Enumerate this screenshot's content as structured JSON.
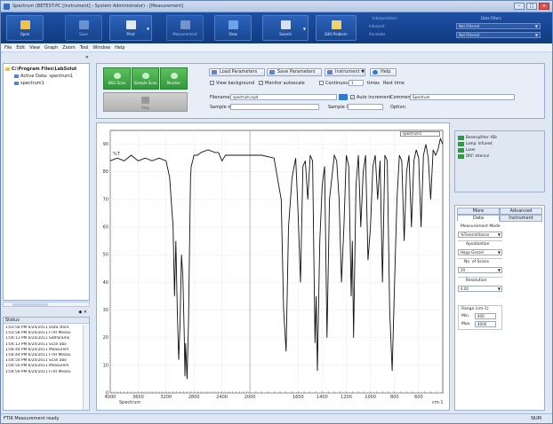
{
  "window": {
    "title": "Spectrum (BETEST-PC [Instrument] - System Administrator) - [Measurement]",
    "controls": [
      "–",
      "□",
      "✕"
    ]
  },
  "ribbon": {
    "buttons": [
      {
        "label": "Open"
      },
      {
        "label": "Save"
      },
      {
        "label": "Print"
      },
      {
        "label": "Measurement"
      },
      {
        "label": "View"
      },
      {
        "label": "Search"
      },
      {
        "label": "Edit Problem"
      }
    ],
    "groups": {
      "interpretation": {
        "label": "Interpretation",
        "items": [
          "Interpret",
          "Annotate"
        ]
      },
      "data_filters": {
        "label": "Data Filters",
        "filter1": "Not Filtered",
        "filter2": "Not Filtered"
      }
    }
  },
  "menu": [
    "File",
    "Edit",
    "View",
    "Graph",
    "Zoom",
    "Tool",
    "Window",
    "Help"
  ],
  "tree": {
    "root": "C:\\Program Files\\LabSolut",
    "items": [
      "Active Data: spectrum1",
      "spectrum1"
    ]
  },
  "status_panel": {
    "title": "Status",
    "lines": [
      "1:03:58 PM 6/20/2011 Data store",
      "1:03:58 PM 6/20/2011 FTIR Measu",
      "1:04:13 PM 6/20/2011 SetParame",
      "1:04:13 PM 6/20/2011 Scan abo",
      "1:04:44 PM 6/20/2011 Measurem",
      "1:04:44 PM 6/20/2011 FTIR Measu",
      "1:04:50 PM 6/20/2011 Scan abo",
      "1:04:50 PM 6/20/2011 Measurem",
      "1:04:59 PM 6/20/2011 FTIR Measu"
    ]
  },
  "controls": {
    "bkg_scan": "BKG Scan",
    "sample_scan": "Sample Scan",
    "monitor": "Monitor",
    "stop": "Stop",
    "load_params": "Load Parameters",
    "save_params": "Save Parameters",
    "instrument": "Instrument",
    "help": "Help",
    "view_background": "View background",
    "monitor_autoscale": "Monitor autoscale",
    "continuous": "Continuous",
    "continuous_count": "1",
    "times_label": "times",
    "rest_time": "Rest time",
    "filename_label": "Filename:",
    "filename_value": "spectrum.ispd",
    "auto_increment": "Auto increment",
    "comment_label": "Comment:",
    "comment_value": "Spectrum",
    "sample_name_label": "Sample name:",
    "sample_id_label": "Sample ID:",
    "option_label": "Option:"
  },
  "chart_legend": "spectrum1",
  "instrument_status": [
    {
      "label": "Beamsplitter: KBr",
      "color": "#2e9a3e"
    },
    {
      "label": "Lamp: Infrared",
      "color": "#2e9a3e"
    },
    {
      "label": "Laser",
      "color": "#2e9a3e"
    },
    {
      "label": "DRF: Internal",
      "color": "#2e9a3e"
    }
  ],
  "settings": {
    "tabs_top": [
      "More",
      "Advanced"
    ],
    "tabs_bottom": [
      "Data",
      "Instrument"
    ],
    "measurement_mode_label": "Measurement Mode",
    "measurement_mode": "%Transmittance",
    "apodization_label": "Apodization",
    "apodization": "Happ-Genzel",
    "scans_label": "No. of Scans",
    "scans": "20",
    "resolution_label": "Resolution",
    "resolution": "4.00",
    "range_label": "Range (cm-1)",
    "min_label": "Min.",
    "min_value": "400",
    "max_label": "Max.",
    "max_value": "4000"
  },
  "statusbar": {
    "text": "FTIR Measurement ready",
    "num": "NUM"
  },
  "chart_data": {
    "type": "line",
    "xlabel": "Spectrum",
    "ylabel": "%T",
    "x_unit": "cm-1",
    "xlim": [
      4000,
      400
    ],
    "ylim": [
      0,
      95
    ],
    "x_ticks": [
      4000,
      3600,
      3200,
      2800,
      2400,
      2000,
      1600,
      1400,
      1200,
      1000,
      800,
      600
    ],
    "y_ticks": [
      0,
      10,
      20,
      30,
      40,
      50,
      60,
      70,
      80,
      90
    ],
    "grid": true,
    "legend": "top-right",
    "series": [
      {
        "name": "spectrum1",
        "x": [
          4000,
          3900,
          3800,
          3700,
          3600,
          3500,
          3400,
          3300,
          3200,
          3150,
          3100,
          3080,
          3060,
          3040,
          3020,
          3000,
          2980,
          2960,
          2940,
          2930,
          2920,
          2900,
          2880,
          2860,
          2850,
          2840,
          2820,
          2800,
          2750,
          2700,
          2600,
          2500,
          2450,
          2400,
          2350,
          2300,
          2200,
          2100,
          2000,
          1900,
          1800,
          1740,
          1720,
          1700,
          1680,
          1650,
          1620,
          1600,
          1580,
          1560,
          1540,
          1520,
          1500,
          1480,
          1460,
          1450,
          1440,
          1420,
          1400,
          1380,
          1370,
          1360,
          1340,
          1300,
          1280,
          1260,
          1240,
          1220,
          1200,
          1180,
          1160,
          1150,
          1140,
          1120,
          1100,
          1080,
          1060,
          1040,
          1020,
          1000,
          980,
          960,
          940,
          920,
          900,
          880,
          860,
          840,
          820,
          800,
          780,
          760,
          740,
          720,
          700,
          680,
          660,
          640,
          620,
          600,
          580,
          560,
          540,
          520,
          500,
          480,
          460,
          440,
          420,
          400
        ],
        "y": [
          84,
          85,
          84,
          86,
          84,
          85,
          84,
          85,
          84,
          78,
          60,
          35,
          55,
          30,
          12,
          25,
          50,
          42,
          20,
          6,
          18,
          5,
          25,
          60,
          78,
          82,
          84,
          86,
          86,
          87,
          88,
          87,
          87,
          84,
          86,
          86,
          86,
          86,
          86,
          86,
          85,
          70,
          30,
          15,
          60,
          78,
          85,
          65,
          40,
          82,
          84,
          70,
          86,
          84,
          18,
          35,
          8,
          55,
          75,
          82,
          50,
          20,
          70,
          86,
          84,
          70,
          40,
          60,
          86,
          82,
          35,
          55,
          20,
          75,
          86,
          60,
          80,
          86,
          48,
          60,
          82,
          86,
          70,
          84,
          40,
          86,
          84,
          30,
          8,
          40,
          70,
          86,
          84,
          55,
          80,
          86,
          60,
          84,
          88,
          85,
          60,
          86,
          90,
          85,
          70,
          88,
          86,
          88,
          92,
          90
        ]
      }
    ]
  }
}
